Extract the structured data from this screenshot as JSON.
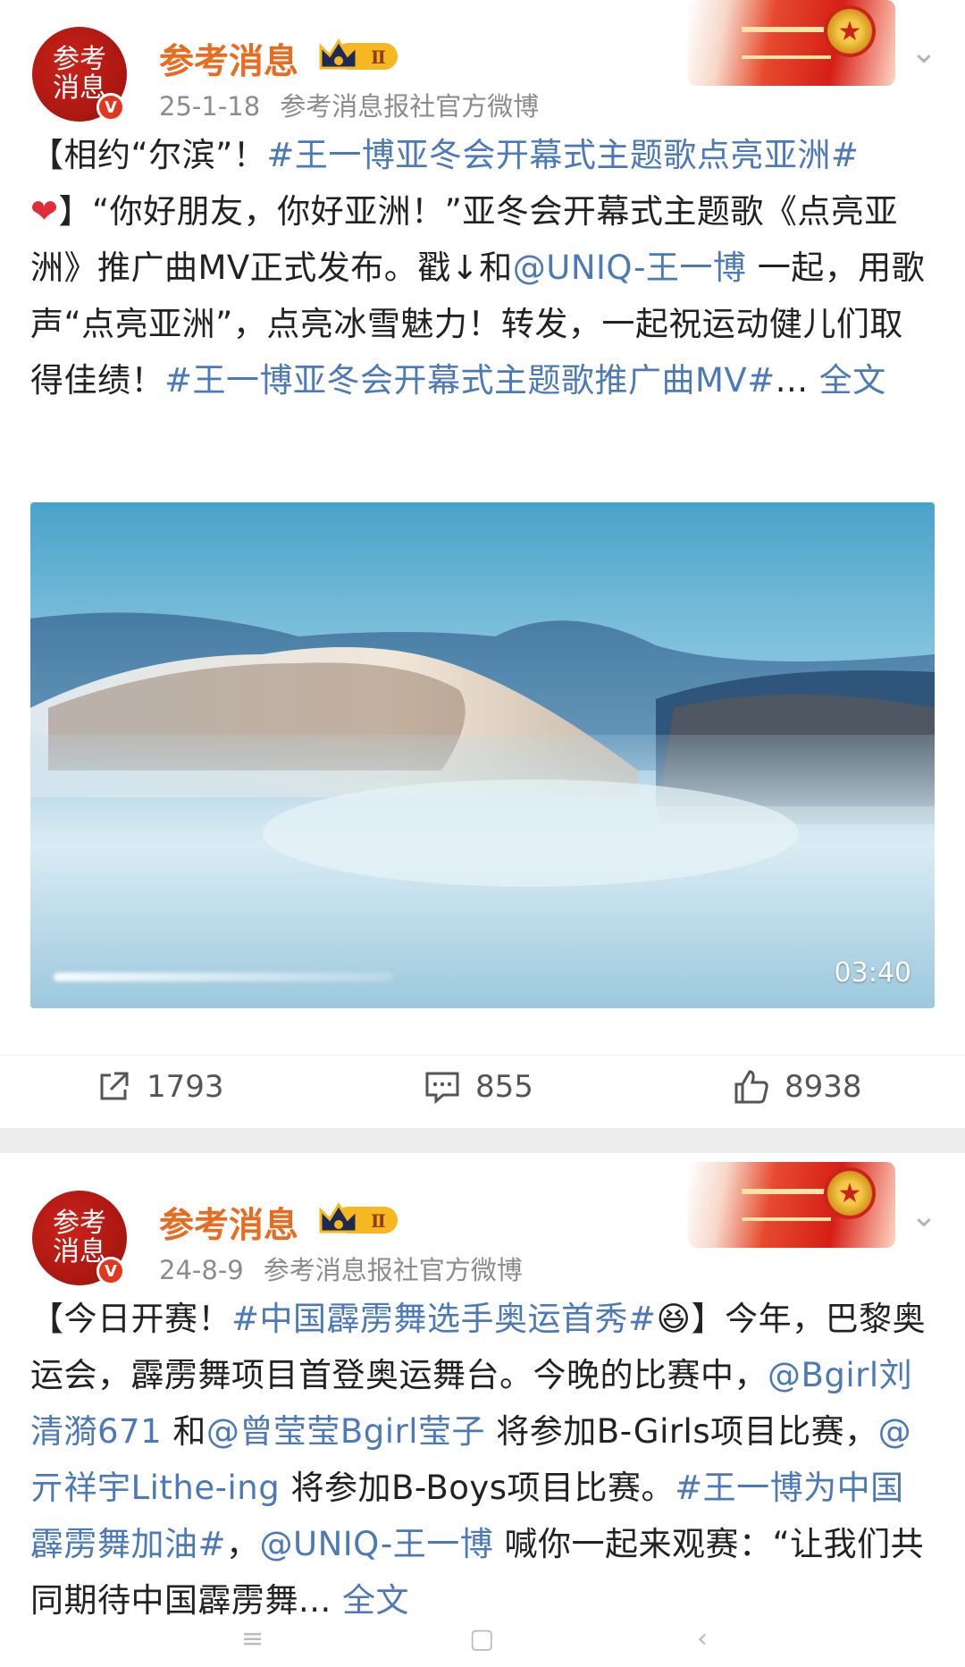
{
  "posts": [
    {
      "author": "参考消息",
      "avatar_text": "参考消息",
      "verified_badge": "V",
      "level": "Ⅱ",
      "date": "25-1-18",
      "source": "参考消息报社官方微博",
      "content": [
        {
          "t": "【相约“尔滨”！"
        },
        {
          "t": "#王一博亚冬会开幕式主题歌点亮亚洲#",
          "link": true
        },
        {
          "t": "❤",
          "heart": true
        },
        {
          "t": "】“你好朋友，你好亚洲！”亚冬会开幕式主题歌《点亮亚洲》推广曲MV正式发布。戳↓和"
        },
        {
          "t": "@UNIQ-王一博",
          "link": true
        },
        {
          "t": " 一起，用歌声“点亮亚洲”，点亮冰雪魅力！转发，一起祝运动健儿们取得佳绩！"
        },
        {
          "t": "#王一博亚冬会开幕式主题歌推广曲MV#",
          "link": true
        },
        {
          "t": "... "
        },
        {
          "t": "全文",
          "link": true
        }
      ],
      "video": {
        "duration": "03:40"
      },
      "actions": {
        "repost": "1793",
        "comment": "855",
        "like": "8938"
      }
    },
    {
      "author": "参考消息",
      "avatar_text": "参考消息",
      "verified_badge": "V",
      "level": "Ⅱ",
      "date": "24-8-9",
      "source": "参考消息报社官方微博",
      "content": [
        {
          "t": "【今日开赛！"
        },
        {
          "t": "#中国霹雳舞选手奥运首秀#",
          "link": true
        },
        {
          "t": "😆"
        },
        {
          "t": "】今年，巴黎奥运会，霹雳舞项目首登奥运舞台。今晚的比赛中，"
        },
        {
          "t": "@Bgirl刘清漪671",
          "link": true
        },
        {
          "t": " 和"
        },
        {
          "t": "@曾莹莹Bgirl莹子",
          "link": true
        },
        {
          "t": " 将参加B-Girls项目比赛，"
        },
        {
          "t": "@亓祥宇Lithe-ing",
          "link": true
        },
        {
          "t": " 将参加B-Boys项目比赛。"
        },
        {
          "t": "#王一博为中国霹雳舞加油#",
          "link": true
        },
        {
          "t": "，"
        },
        {
          "t": "@UNIQ-王一博",
          "link": true
        },
        {
          "t": " 喊你一起来观赛：“让我们共同期待中国霹雳舞... "
        },
        {
          "t": "全文",
          "link": true
        }
      ]
    }
  ],
  "colors": {
    "author": "#e86b1f",
    "link": "#4c79b8",
    "meta": "#8c8c8c",
    "badge": "#e2371e"
  },
  "icons": {
    "repost": "share-icon",
    "comment": "comment-icon",
    "like": "thumbs-up-icon",
    "more": "chevron-down-icon"
  },
  "navbar": {
    "items": [
      "menu-icon",
      "home-icon",
      "back-icon"
    ]
  }
}
